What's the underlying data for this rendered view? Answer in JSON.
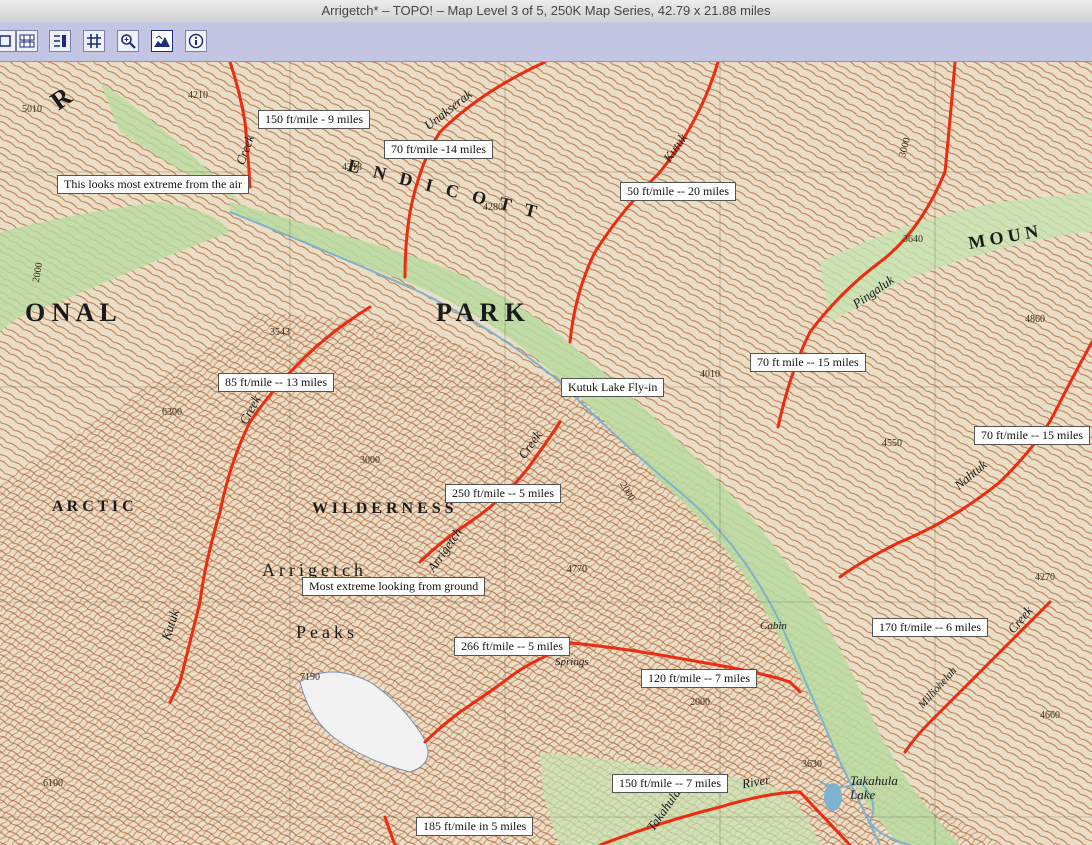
{
  "window": {
    "title": "Arrigetch* – TOPO! – Map Level 3 of 5, 250K Map Series, 42.79 x 21.88 miles"
  },
  "toolbar": {
    "tools": [
      {
        "name": "select-tool-icon"
      },
      {
        "name": "overview-icon"
      },
      {
        "name": "route-tool-icon"
      },
      {
        "name": "grid-icon"
      },
      {
        "name": "zoom-icon"
      },
      {
        "name": "elevation-profile-icon"
      },
      {
        "name": "info-icon"
      }
    ]
  },
  "annotations": {
    "a1": "150 ft/mile - 9 miles",
    "a2": "70 ft/mile -14 miles",
    "a3": "This looks most extreme from the air",
    "a4": "50 ft/mile -- 20 miles",
    "a5": "85 ft/mile -- 13 miles",
    "a6": "Kutuk Lake Fly-in",
    "a7": "70 ft mile -- 15 miles",
    "a8": "70 ft/mile -- 15 miles",
    "a9": "250 ft/mile -- 5 miles",
    "a10": "Most extreme looking from ground",
    "a11": "266 ft/mile -- 5 miles",
    "a12": "170 ft/mile -- 6 miles",
    "a13": "120 ft/mile  -- 7 miles",
    "a14": "150 ft/mile -- 7 miles",
    "a15": "185 ft/mile in 5 miles"
  },
  "places": {
    "endicott": "ENDICOTT",
    "national": "O N A L",
    "park": "P A R K",
    "mountains": "M O U N",
    "arctic": "A R C T I C",
    "wilderness": "W I L D E R N E S S",
    "arrigetch": "Arrigetch",
    "peaks": "Peaks",
    "r_letter": "R",
    "unakserak": "Unakserak",
    "kutuk": "Kutuk",
    "pingaluk": "Pingaluk",
    "nahtuk": "Nahtuk",
    "creek_1": "Creek",
    "creek_2": "Creek",
    "creek_3": "Creek",
    "arrigetch_creek": "Arrigetch",
    "kutuk_lower": "Kutuk",
    "takahula_lake": "Takahula Lake",
    "takahula_river": "Takahula",
    "river": "River",
    "cabin": "Cabin",
    "springs": "Springs",
    "milliohelah": "Milliohelah"
  },
  "elevations": {
    "e1": "5010",
    "e2": "4210",
    "e3": "4280",
    "e4": "4318",
    "e5": "2000",
    "e6": "3543",
    "e7": "6300",
    "e8": "3000",
    "e9": "4770",
    "e10": "2000",
    "e11": "4010",
    "e12": "4550",
    "e13": "4860",
    "e14": "3640",
    "e15": "4270",
    "e16": "4660",
    "e17": "7190",
    "e18": "2000",
    "e19": "3630",
    "e20": "6100",
    "e21": "3000"
  },
  "colors": {
    "route": "#ee2b10",
    "contour": "#b5653d",
    "valley": "#b8dca0",
    "water": "#7fb2cf"
  }
}
